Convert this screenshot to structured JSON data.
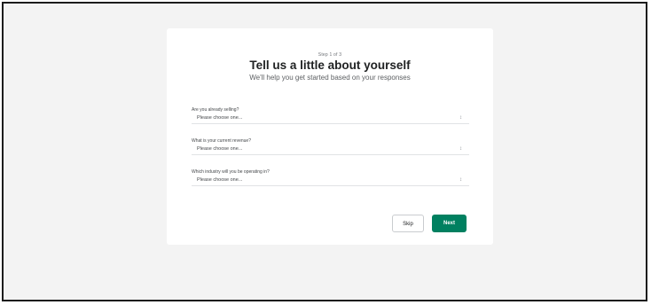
{
  "onboarding": {
    "step": "Step 1 of 3",
    "title": "Tell us a little about yourself",
    "subtitle": "We'll help you get started based on your responses",
    "questions": [
      {
        "label": "Are you already selling?",
        "value": "Please choose one..."
      },
      {
        "label": "What is your current revenue?",
        "value": "Please choose one..."
      },
      {
        "label": "Which industry will you be operating in?",
        "value": "Please choose one..."
      }
    ],
    "skip_label": "Skip",
    "next_label": "Next",
    "select_icon": "chevron-up-down-icon"
  },
  "colors": {
    "accent": "#008060",
    "background": "#f3f3f3",
    "card": "#ffffff"
  }
}
